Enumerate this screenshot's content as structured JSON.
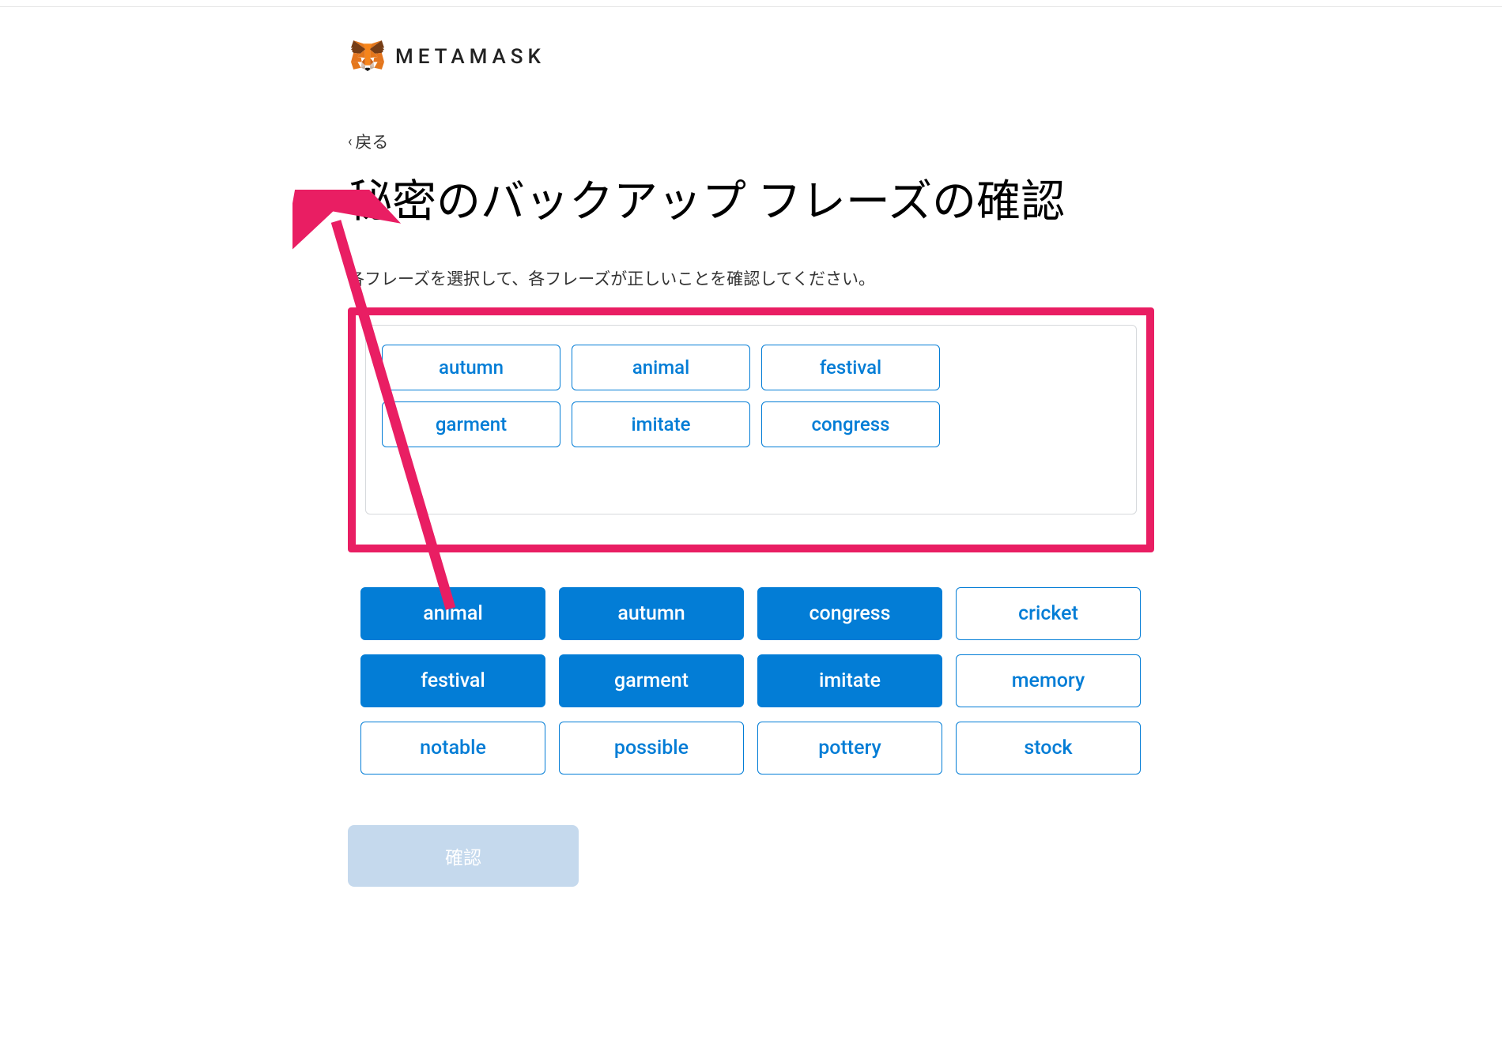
{
  "brand": {
    "name": "METAMASK"
  },
  "back": {
    "label": "戻る"
  },
  "page_title": "秘密のバックアップ フレーズの確認",
  "instruction": "各フレーズを選択して、各フレーズが正しいことを確認してください。",
  "selected_words": [
    "autumn",
    "animal",
    "festival",
    "garment",
    "imitate",
    "congress"
  ],
  "word_bank": [
    {
      "word": "animal",
      "selected": true
    },
    {
      "word": "autumn",
      "selected": true
    },
    {
      "word": "congress",
      "selected": true
    },
    {
      "word": "cricket",
      "selected": false
    },
    {
      "word": "festival",
      "selected": true
    },
    {
      "word": "garment",
      "selected": true
    },
    {
      "word": "imitate",
      "selected": true
    },
    {
      "word": "memory",
      "selected": false
    },
    {
      "word": "notable",
      "selected": false
    },
    {
      "word": "possible",
      "selected": false
    },
    {
      "word": "pottery",
      "selected": false
    },
    {
      "word": "stock",
      "selected": false
    }
  ],
  "confirm": {
    "label": "確認"
  },
  "colors": {
    "primary": "#037dd6",
    "annotation": "#e91e63",
    "disabled_button": "#c5d9ed"
  }
}
